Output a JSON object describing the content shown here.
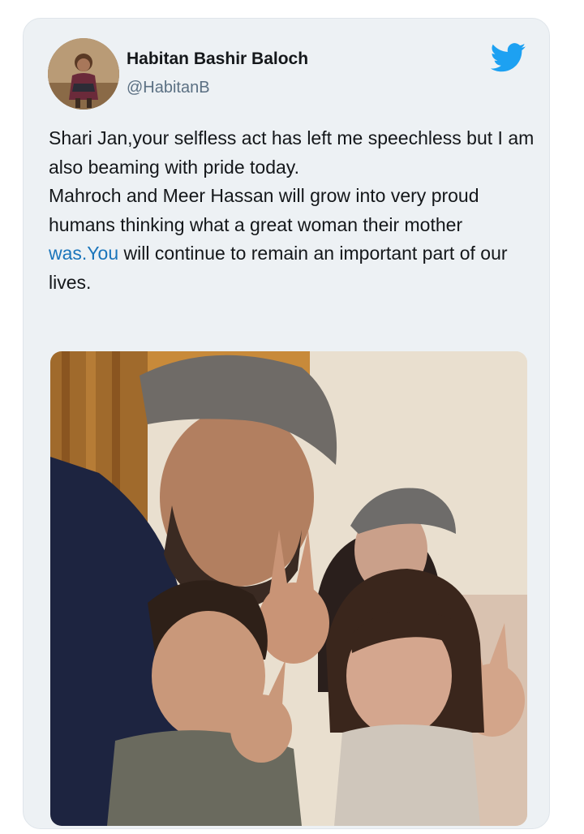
{
  "tweet": {
    "author_name": "Habitan Bashir Baloch",
    "author_handle": "@HabitanB",
    "text_line_1": "Shari Jan,your selfless act has left me speechless but I am also beaming with pride today.",
    "text_line_2_before": "Mahroch and Meer Hassan will grow into very proud humans thinking what a great woman their mother ",
    "text_line_2_link": "was.You",
    "text_line_2_after": " will continue to remain an important part of our lives."
  },
  "icons": {
    "brand": "twitter-bird-icon",
    "brand_color": "#1da1f2"
  },
  "colors": {
    "card_background": "#edf1f4",
    "text": "#14171a",
    "handle": "#5b7083",
    "link": "#1b75bb"
  }
}
